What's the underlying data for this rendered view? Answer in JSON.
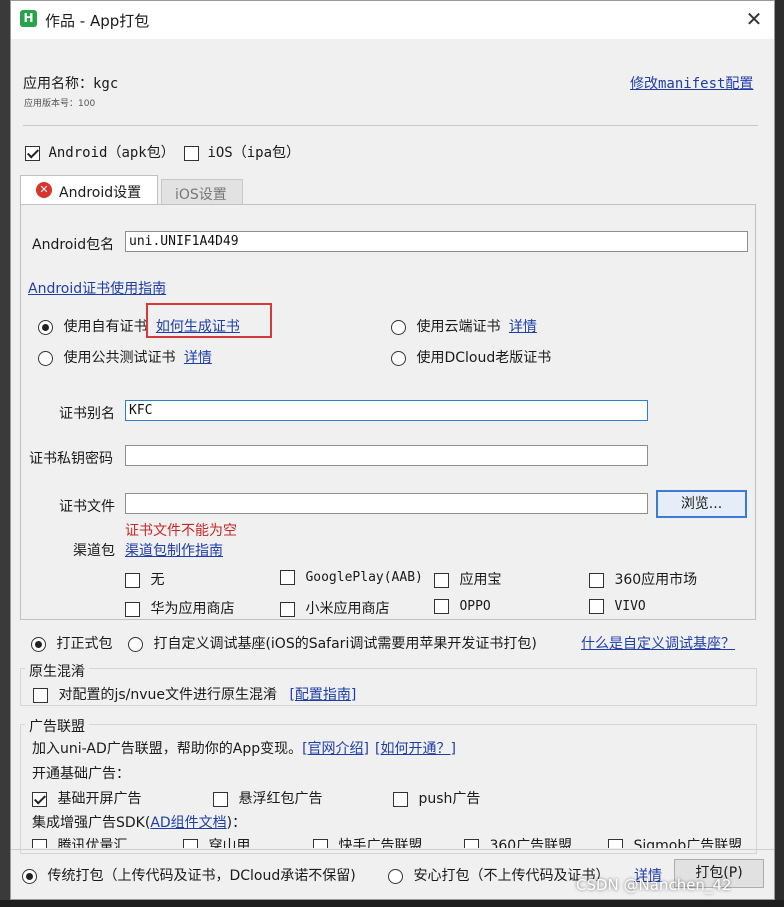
{
  "window": {
    "title": "作品 - App打包",
    "close": "✕",
    "icon_letter": "H"
  },
  "header": {
    "app_name_label": "应用名称：",
    "app_name": "kgc",
    "version_text": "应用版本号：100",
    "manifest_link": "修改manifest配置"
  },
  "platforms": {
    "android_label": "Android（apk包）",
    "android_checked": true,
    "ios_label": "iOS（ipa包）",
    "ios_checked": false
  },
  "tabs": {
    "android": "Android设置",
    "ios": "iOS设置"
  },
  "android": {
    "package_label": "Android包名",
    "package_value": "uni.UNIF1A4D49",
    "cert_guide_link": "Android证书使用指南",
    "cert_options": {
      "own": "使用自有证书",
      "own_link": "如何生成证书",
      "cloud": "使用云端证书",
      "cloud_link": "详情",
      "public_test": "使用公共测试证书",
      "public_link": "详情",
      "dcloud_old": "使用DCloud老版证书"
    },
    "alias_label": "证书别名",
    "alias_value": "KFC",
    "password_label": "证书私钥密码",
    "password_value": "",
    "file_label": "证书文件",
    "file_value": "",
    "browse_button": "浏览...",
    "file_error": "证书文件不能为空",
    "channel_label": "渠道包",
    "channel_link": "渠道包制作指南",
    "channels": [
      "无",
      "GooglePlay(AAB)",
      "应用宝",
      "360应用市场",
      "华为应用商店",
      "小米应用商店",
      "OPPO",
      "VIVO"
    ]
  },
  "build_type": {
    "formal": "打正式包",
    "custom": "打自定义调试基座(iOS的Safari调试需要用苹果开发证书打包)",
    "custom_link": "什么是自定义调试基座？"
  },
  "obfuscation": {
    "title": "原生混淆",
    "option": "对配置的js/nvue文件进行原生混淆",
    "link": "[配置指南]"
  },
  "ads": {
    "title": "广告联盟",
    "intro": "加入uni-AD广告联盟，帮助你的App变现。",
    "link_official": "[官网介绍]",
    "link_how": "[如何开通？]",
    "basic_label": "开通基础广告：",
    "basic_items": [
      "基础开屏广告",
      "悬浮红包广告",
      "push广告"
    ],
    "basic_checked": [
      true,
      false,
      false
    ],
    "enhanced_prefix": "集成增强广告SDK(",
    "enhanced_link": "AD组件文档",
    "enhanced_suffix": ")：",
    "enhanced_items": [
      "腾讯优量汇",
      "穿山甲",
      "快手广告联盟",
      "360广告联盟",
      "Sigmob广告联盟"
    ]
  },
  "footer": {
    "traditional": "传统打包（上传代码及证书，DCloud承诺不保留)",
    "safe": "安心打包（不上传代码及证书）",
    "details_link": "详情",
    "pack_button": "打包(P)"
  },
  "watermark": "CSDN @Nanchen_42",
  "colors": {
    "link": "#1f3ea8",
    "error": "#d43a3a",
    "dialog_bg": "#f0f0f0",
    "focus": "#2a7fcf"
  }
}
